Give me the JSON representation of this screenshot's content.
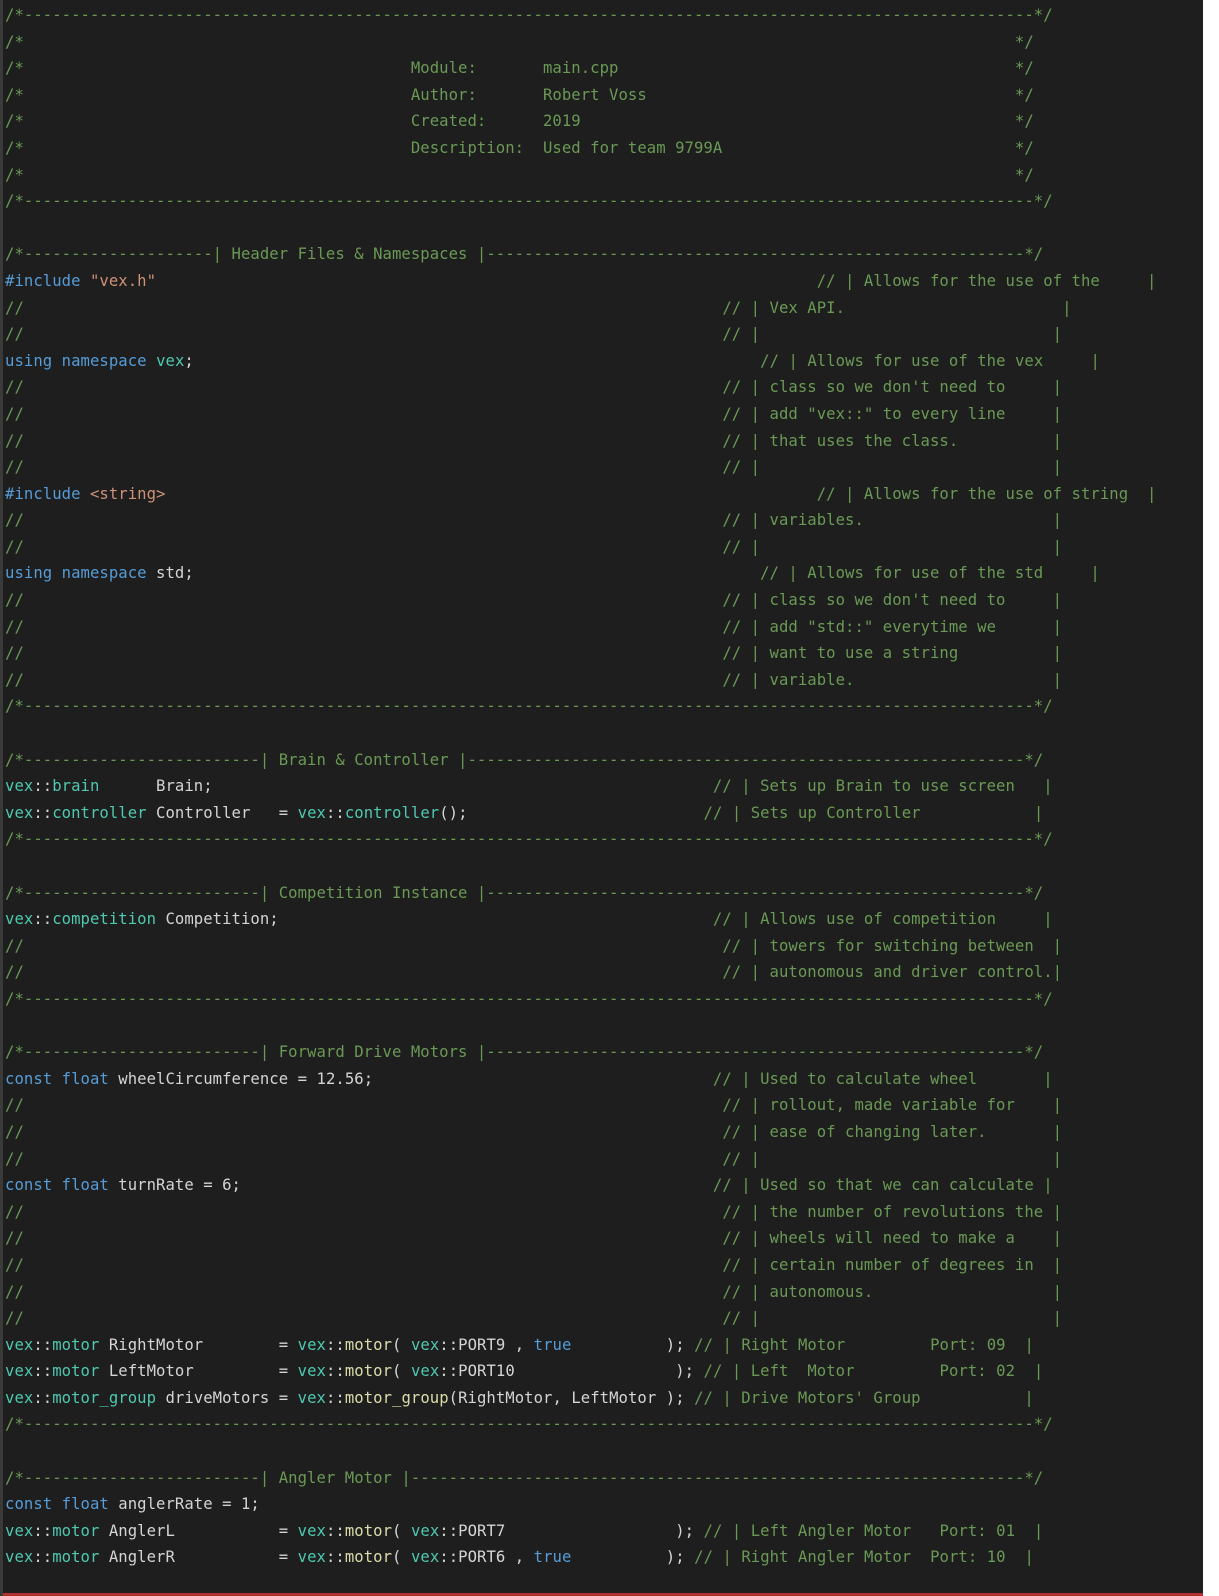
{
  "editor": {
    "file_name": "main.cpp",
    "lines": [
      [
        {
          "t": "/*-----------------------------------------------------------------------------------------------------------*/",
          "c": "c"
        }
      ],
      [
        {
          "t": "/*                                                                                                         */",
          "c": "c"
        }
      ],
      [
        {
          "t": "/*                                         Module:       main.cpp                                          */",
          "c": "c"
        }
      ],
      [
        {
          "t": "/*                                         Author:       Robert Voss                                       */",
          "c": "c"
        }
      ],
      [
        {
          "t": "/*                                         Created:      2019                                              */",
          "c": "c"
        }
      ],
      [
        {
          "t": "/*                                         Description:  Used for team 9799A                               */",
          "c": "c"
        }
      ],
      [
        {
          "t": "/*                                                                                                         */",
          "c": "c"
        }
      ],
      [
        {
          "t": "/*-----------------------------------------------------------------------------------------------------------*/",
          "c": "c"
        }
      ],
      [
        {
          "t": "",
          "c": "p"
        }
      ],
      [
        {
          "t": "/*--------------------| Header Files & Namespaces |---------------------------------------------------------*/",
          "c": "c"
        }
      ],
      [
        {
          "t": "#include ",
          "c": "k"
        },
        {
          "t": "\"vex.h\"",
          "c": "s"
        },
        {
          "t": "                                                                      ",
          "c": "p"
        },
        {
          "t": "// | Allows for the use of the     |",
          "c": "c"
        }
      ],
      [
        {
          "t": "//                                                                          ",
          "c": "c"
        },
        {
          "t": "// | Vex API.                       |",
          "c": "c"
        }
      ],
      [
        {
          "t": "//                                                                          ",
          "c": "c"
        },
        {
          "t": "// |                               |",
          "c": "c"
        }
      ],
      [
        {
          "t": "using",
          "c": "k"
        },
        {
          "t": " ",
          "c": "p"
        },
        {
          "t": "namespace",
          "c": "k"
        },
        {
          "t": " ",
          "c": "p"
        },
        {
          "t": "vex",
          "c": "t"
        },
        {
          "t": ";                                                            ",
          "c": "p"
        },
        {
          "t": "// | Allows for use of the vex     |",
          "c": "c"
        }
      ],
      [
        {
          "t": "//                                                                          ",
          "c": "c"
        },
        {
          "t": "// | class so we don't need to     |",
          "c": "c"
        }
      ],
      [
        {
          "t": "//                                                                          ",
          "c": "c"
        },
        {
          "t": "// | add \"vex::\" to every line     |",
          "c": "c"
        }
      ],
      [
        {
          "t": "//                                                                          ",
          "c": "c"
        },
        {
          "t": "// | that uses the class.          |",
          "c": "c"
        }
      ],
      [
        {
          "t": "//                                                                          ",
          "c": "c"
        },
        {
          "t": "// |                               |",
          "c": "c"
        }
      ],
      [
        {
          "t": "#include ",
          "c": "k"
        },
        {
          "t": "<string>",
          "c": "s"
        },
        {
          "t": "                                                                     ",
          "c": "p"
        },
        {
          "t": "// | Allows for the use of string  |",
          "c": "c"
        }
      ],
      [
        {
          "t": "//                                                                          ",
          "c": "c"
        },
        {
          "t": "// | variables.                    |",
          "c": "c"
        }
      ],
      [
        {
          "t": "//                                                                          ",
          "c": "c"
        },
        {
          "t": "// |                               |",
          "c": "c"
        }
      ],
      [
        {
          "t": "using",
          "c": "k"
        },
        {
          "t": " ",
          "c": "p"
        },
        {
          "t": "namespace",
          "c": "k"
        },
        {
          "t": " std;                                                            ",
          "c": "p"
        },
        {
          "t": "// | Allows for use of the std     |",
          "c": "c"
        }
      ],
      [
        {
          "t": "//                                                                          ",
          "c": "c"
        },
        {
          "t": "// | class so we don't need to     |",
          "c": "c"
        }
      ],
      [
        {
          "t": "//                                                                          ",
          "c": "c"
        },
        {
          "t": "// | add \"std::\" everytime we      |",
          "c": "c"
        }
      ],
      [
        {
          "t": "//                                                                          ",
          "c": "c"
        },
        {
          "t": "// | want to use a string          |",
          "c": "c"
        }
      ],
      [
        {
          "t": "//                                                                          ",
          "c": "c"
        },
        {
          "t": "// | variable.                     |",
          "c": "c"
        }
      ],
      [
        {
          "t": "/*-----------------------------------------------------------------------------------------------------------*/",
          "c": "c"
        }
      ],
      [
        {
          "t": "",
          "c": "p"
        }
      ],
      [
        {
          "t": "/*-------------------------| Brain & Controller |-----------------------------------------------------------*/",
          "c": "c"
        }
      ],
      [
        {
          "t": "vex",
          "c": "t"
        },
        {
          "t": "::",
          "c": "p"
        },
        {
          "t": "brain",
          "c": "t"
        },
        {
          "t": "      Brain;                                                     ",
          "c": "p"
        },
        {
          "t": "// | Sets up Brain to use screen   |",
          "c": "c"
        }
      ],
      [
        {
          "t": "vex",
          "c": "t"
        },
        {
          "t": "::",
          "c": "p"
        },
        {
          "t": "controller",
          "c": "t"
        },
        {
          "t": " Controller   = ",
          "c": "p"
        },
        {
          "t": "vex",
          "c": "t"
        },
        {
          "t": "::",
          "c": "p"
        },
        {
          "t": "controller",
          "c": "t"
        },
        {
          "t": "();                         ",
          "c": "p"
        },
        {
          "t": "// | Sets up Controller            |",
          "c": "c"
        }
      ],
      [
        {
          "t": "/*-----------------------------------------------------------------------------------------------------------*/",
          "c": "c"
        }
      ],
      [
        {
          "t": "",
          "c": "p"
        }
      ],
      [
        {
          "t": "/*-------------------------| Competition Instance |---------------------------------------------------------*/",
          "c": "c"
        }
      ],
      [
        {
          "t": "vex",
          "c": "t"
        },
        {
          "t": "::",
          "c": "p"
        },
        {
          "t": "competition",
          "c": "t"
        },
        {
          "t": " Competition;                                              ",
          "c": "p"
        },
        {
          "t": "// | Allows use of competition     |",
          "c": "c"
        }
      ],
      [
        {
          "t": "//                                                                          ",
          "c": "c"
        },
        {
          "t": "// | towers for switching between  |",
          "c": "c"
        }
      ],
      [
        {
          "t": "//                                                                          ",
          "c": "c"
        },
        {
          "t": "// | autonomous and driver control.|",
          "c": "c"
        }
      ],
      [
        {
          "t": "/*-----------------------------------------------------------------------------------------------------------*/",
          "c": "c"
        }
      ],
      [
        {
          "t": "",
          "c": "p"
        }
      ],
      [
        {
          "t": "/*-------------------------| Forward Drive Motors |---------------------------------------------------------*/",
          "c": "c"
        }
      ],
      [
        {
          "t": "const",
          "c": "k"
        },
        {
          "t": " ",
          "c": "p"
        },
        {
          "t": "float",
          "c": "k"
        },
        {
          "t": " wheelCircumference = 12.56;                                    ",
          "c": "p"
        },
        {
          "t": "// | Used to calculate wheel       |",
          "c": "c"
        }
      ],
      [
        {
          "t": "//                                                                          ",
          "c": "c"
        },
        {
          "t": "// | rollout, made variable for    |",
          "c": "c"
        }
      ],
      [
        {
          "t": "//                                                                          ",
          "c": "c"
        },
        {
          "t": "// | ease of changing later.       |",
          "c": "c"
        }
      ],
      [
        {
          "t": "//                                                                          ",
          "c": "c"
        },
        {
          "t": "// |                               |",
          "c": "c"
        }
      ],
      [
        {
          "t": "const",
          "c": "k"
        },
        {
          "t": " ",
          "c": "p"
        },
        {
          "t": "float",
          "c": "k"
        },
        {
          "t": " turnRate = 6;                                                  ",
          "c": "p"
        },
        {
          "t": "// | Used so that we can calculate |",
          "c": "c"
        }
      ],
      [
        {
          "t": "//                                                                          ",
          "c": "c"
        },
        {
          "t": "// | the number of revolutions the |",
          "c": "c"
        }
      ],
      [
        {
          "t": "//                                                                          ",
          "c": "c"
        },
        {
          "t": "// | wheels will need to make a    |",
          "c": "c"
        }
      ],
      [
        {
          "t": "//                                                                          ",
          "c": "c"
        },
        {
          "t": "// | certain number of degrees in  |",
          "c": "c"
        }
      ],
      [
        {
          "t": "//                                                                          ",
          "c": "c"
        },
        {
          "t": "// | autonomous.                   |",
          "c": "c"
        }
      ],
      [
        {
          "t": "//                                                                          ",
          "c": "c"
        },
        {
          "t": "// |                               |",
          "c": "c"
        }
      ],
      [
        {
          "t": "vex",
          "c": "t"
        },
        {
          "t": "::",
          "c": "p"
        },
        {
          "t": "motor",
          "c": "t"
        },
        {
          "t": " RightMotor        = ",
          "c": "p"
        },
        {
          "t": "vex",
          "c": "t"
        },
        {
          "t": "::",
          "c": "p"
        },
        {
          "t": "motor",
          "c": "f"
        },
        {
          "t": "( ",
          "c": "p"
        },
        {
          "t": "vex",
          "c": "t"
        },
        {
          "t": "::PORT9 , ",
          "c": "p"
        },
        {
          "t": "true",
          "c": "k"
        },
        {
          "t": "          ); ",
          "c": "p"
        },
        {
          "t": "// | Right Motor         Port: 09  |",
          "c": "c"
        }
      ],
      [
        {
          "t": "vex",
          "c": "t"
        },
        {
          "t": "::",
          "c": "p"
        },
        {
          "t": "motor",
          "c": "t"
        },
        {
          "t": " LeftMotor         = ",
          "c": "p"
        },
        {
          "t": "vex",
          "c": "t"
        },
        {
          "t": "::",
          "c": "p"
        },
        {
          "t": "motor",
          "c": "f"
        },
        {
          "t": "( ",
          "c": "p"
        },
        {
          "t": "vex",
          "c": "t"
        },
        {
          "t": "::PORT10                 ); ",
          "c": "p"
        },
        {
          "t": "// | Left  Motor         Port: 02  |",
          "c": "c"
        }
      ],
      [
        {
          "t": "vex",
          "c": "t"
        },
        {
          "t": "::",
          "c": "p"
        },
        {
          "t": "motor_group",
          "c": "t"
        },
        {
          "t": " driveMotors = ",
          "c": "p"
        },
        {
          "t": "vex",
          "c": "t"
        },
        {
          "t": "::",
          "c": "p"
        },
        {
          "t": "motor_group",
          "c": "f"
        },
        {
          "t": "(RightMotor, LeftMotor ); ",
          "c": "p"
        },
        {
          "t": "// | Drive Motors' Group           |",
          "c": "c"
        }
      ],
      [
        {
          "t": "/*-----------------------------------------------------------------------------------------------------------*/",
          "c": "c"
        }
      ],
      [
        {
          "t": "",
          "c": "p"
        }
      ],
      [
        {
          "t": "/*-------------------------| Angler Motor |-----------------------------------------------------------------*/",
          "c": "c"
        }
      ],
      [
        {
          "t": "const",
          "c": "k"
        },
        {
          "t": " ",
          "c": "p"
        },
        {
          "t": "float",
          "c": "k"
        },
        {
          "t": " anglerRate = 1;",
          "c": "p"
        }
      ],
      [
        {
          "t": "vex",
          "c": "t"
        },
        {
          "t": "::",
          "c": "p"
        },
        {
          "t": "motor",
          "c": "t"
        },
        {
          "t": " AnglerL           = ",
          "c": "p"
        },
        {
          "t": "vex",
          "c": "t"
        },
        {
          "t": "::",
          "c": "p"
        },
        {
          "t": "motor",
          "c": "f"
        },
        {
          "t": "( ",
          "c": "p"
        },
        {
          "t": "vex",
          "c": "t"
        },
        {
          "t": "::PORT7                  ); ",
          "c": "p"
        },
        {
          "t": "// | Left Angler Motor   Port: 01  |",
          "c": "c"
        }
      ],
      [
        {
          "t": "vex",
          "c": "t"
        },
        {
          "t": "::",
          "c": "p"
        },
        {
          "t": "motor",
          "c": "t"
        },
        {
          "t": " AnglerR           = ",
          "c": "p"
        },
        {
          "t": "vex",
          "c": "t"
        },
        {
          "t": "::",
          "c": "p"
        },
        {
          "t": "motor",
          "c": "f"
        },
        {
          "t": "( ",
          "c": "p"
        },
        {
          "t": "vex",
          "c": "t"
        },
        {
          "t": "::PORT6 , ",
          "c": "p"
        },
        {
          "t": "true",
          "c": "k"
        },
        {
          "t": "          ); ",
          "c": "p"
        },
        {
          "t": "// | Right Angler Motor  Port: 10  |",
          "c": "c"
        }
      ]
    ]
  }
}
